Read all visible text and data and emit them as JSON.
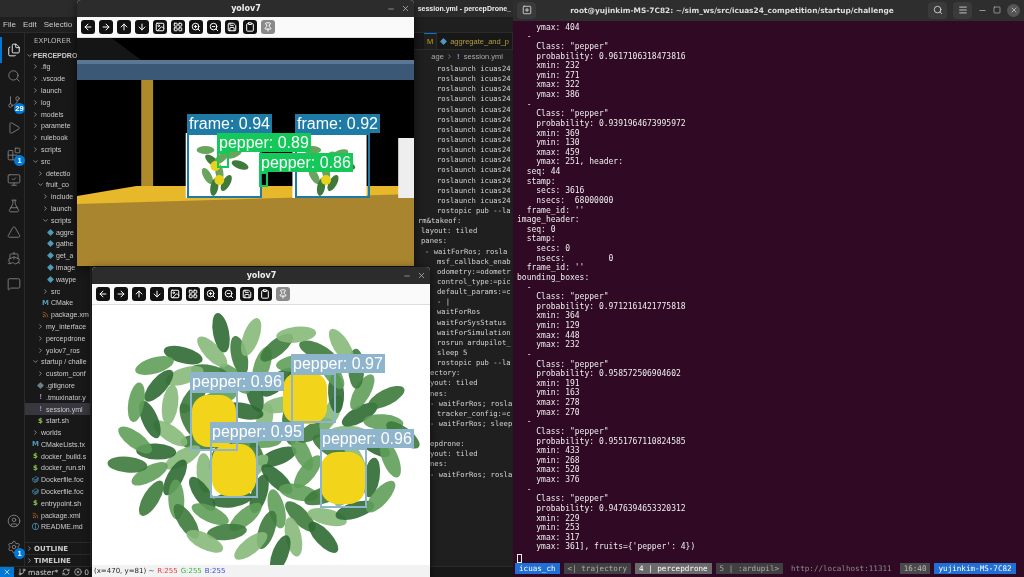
{
  "vscode": {
    "title": "session.yml - percepDrone_",
    "menu": [
      "File",
      "Edit",
      "Selectio"
    ],
    "activity": [
      {
        "kind": "files",
        "selected": true
      },
      {
        "kind": "search",
        "selected": false
      },
      {
        "kind": "source-control",
        "selected": false,
        "badge": "29"
      },
      {
        "kind": "run",
        "selected": false
      },
      {
        "kind": "extensions",
        "selected": false,
        "badge": "1"
      },
      {
        "kind": "remote",
        "selected": false
      },
      {
        "kind": "testing",
        "selected": false
      },
      {
        "kind": "deploy",
        "selected": false
      },
      {
        "kind": "docker",
        "selected": false
      },
      {
        "kind": "chat",
        "selected": false
      }
    ],
    "activity_bottom": [
      {
        "kind": "account",
        "selected": false
      },
      {
        "kind": "settings",
        "selected": false,
        "badge": "1"
      }
    ],
    "explorer": {
      "title": "EXPLORER",
      "root": "PERCEPDRO",
      "tree": [
        {
          "name": ".fig",
          "kind": "folder",
          "expanded": false,
          "selected": false
        },
        {
          "name": ".vscode",
          "kind": "folder",
          "expanded": false,
          "selected": false
        },
        {
          "name": "launch",
          "kind": "folder",
          "expanded": false,
          "selected": false
        },
        {
          "name": "log",
          "kind": "folder",
          "expanded": false,
          "selected": false
        },
        {
          "name": "models",
          "kind": "folder",
          "expanded": false,
          "selected": false
        },
        {
          "name": "paramete",
          "kind": "folder",
          "expanded": false,
          "selected": false
        },
        {
          "name": "rulebook",
          "kind": "folder",
          "expanded": false,
          "selected": false
        },
        {
          "name": "scripts",
          "kind": "folder",
          "expanded": false,
          "selected": false
        },
        {
          "name": "src",
          "kind": "folder",
          "expanded": true,
          "selected": false,
          "children": [
            {
              "name": "detectio",
              "kind": "folder",
              "expanded": false,
              "selected": false
            },
            {
              "name": "fruit_co",
              "kind": "folder",
              "expanded": true,
              "selected": false,
              "children": [
                {
                  "name": "include",
                  "kind": "folder",
                  "expanded": false,
                  "selected": false
                },
                {
                  "name": "launch",
                  "kind": "folder",
                  "expanded": false,
                  "selected": false
                },
                {
                  "name": "scripts",
                  "kind": "folder",
                  "expanded": true,
                  "selected": false,
                  "children": [
                    {
                      "name": "aggre",
                      "kind": "python",
                      "selected": false
                    },
                    {
                      "name": "gathe",
                      "kind": "python",
                      "selected": false
                    },
                    {
                      "name": "get_a",
                      "kind": "python",
                      "selected": false
                    },
                    {
                      "name": "image",
                      "kind": "python",
                      "selected": false
                    },
                    {
                      "name": "waype",
                      "kind": "python",
                      "selected": false
                    }
                  ]
                },
                {
                  "name": "src",
                  "kind": "folder",
                  "expanded": false,
                  "selected": false
                },
                {
                  "name": "CMake",
                  "kind": "cmake",
                  "glyph": "M",
                  "selected": false
                },
                {
                  "name": "package.xm",
                  "kind": "xml",
                  "selected": false
                }
              ]
            },
            {
              "name": "my_interface",
              "kind": "folder",
              "expanded": false,
              "selected": false
            },
            {
              "name": "percepdrone",
              "kind": "folder",
              "expanded": false,
              "selected": false
            },
            {
              "name": "yolov7_ros",
              "kind": "folder",
              "expanded": false,
              "selected": false
            }
          ]
        },
        {
          "name": "startup / challe",
          "kind": "folder",
          "expanded": true,
          "selected": false,
          "children": [
            {
              "name": "custom_conf",
              "kind": "folder",
              "expanded": false,
              "selected": false
            },
            {
              "name": ".gitignore",
              "kind": "git",
              "selected": false
            },
            {
              "name": ".tmuxinator.y",
              "kind": "yaml",
              "glyph": "!",
              "selected": false
            },
            {
              "name": "session.yml",
              "kind": "yaml",
              "glyph": "!",
              "selected": true
            },
            {
              "name": "start.sh",
              "kind": "shell",
              "glyph": "$",
              "selected": false
            }
          ]
        },
        {
          "name": "worlds",
          "kind": "folder",
          "expanded": false,
          "selected": false
        },
        {
          "name": "CMakeLists.tx",
          "kind": "cmake",
          "glyph": "M",
          "selected": false
        },
        {
          "name": "docker_build.s",
          "kind": "shell",
          "glyph": "$",
          "selected": false
        },
        {
          "name": "docker_run.sh",
          "kind": "shell",
          "glyph": "$",
          "selected": false
        },
        {
          "name": "Dockerfile.foc",
          "kind": "docker",
          "selected": false
        },
        {
          "name": "Dockerfile.foc",
          "kind": "docker",
          "selected": false
        },
        {
          "name": "entrypoint.sh",
          "kind": "shell",
          "glyph": "$",
          "selected": false
        },
        {
          "name": "package.xml",
          "kind": "xml",
          "selected": false
        },
        {
          "name": "README.md",
          "kind": "info",
          "glyph": "ⓘ",
          "selected": false
        }
      ],
      "sections": [
        "OUTLINE",
        "TIMELINE"
      ]
    },
    "tabs": [
      {
        "label": "M",
        "selected": true
      },
      {
        "label": "aggregate_and_p",
        "selected": false
      }
    ],
    "breadcrumb": {
      "folder": "age",
      "icon": "!",
      "file": "session.yml"
    },
    "code": [
      "roslaunch icuas24",
      "roslaunch icuas24",
      "roslaunch icuas24",
      "roslaunch icuas24",
      "roslaunch icuas24",
      "roslaunch icuas24",
      "roslaunch icuas24",
      "roslaunch icuas24",
      "roslaunch icuas24",
      "roslaunch icuas24",
      "roslaunch icuas24",
      "roslaunch icuas24",
      "roslaunch icuas24",
      "roslaunch icuas24",
      "rostopic pub --la",
      "rm&takeof:",
      "layout: tiled",
      "panes:",
      "- waitForRos; rosla",
      "msf_callback_enab",
      "odometry:=odometr",
      "control_type:=pic",
      "default_params:=c",
      "- |",
      "waitForRos",
      "waitForSysStatus",
      "waitForSimulation",
      "rosrun ardupilot_",
      "sleep 5",
      "rostopic pub --la",
      "ectory:",
      "yout: tiled",
      "nes:",
      "- waitForRos; rosla",
      "tracker_config:=c",
      "- waitForRos; sleep",
      "epdrone:",
      "yout: tiled",
      "nes:",
      "- waitForRos; rosla"
    ],
    "status": {
      "branch": "master*",
      "errors": "0"
    }
  },
  "terminal": {
    "title": "root@yujinkim-MS-7C82: ~/sim_ws/src/icuas24_competition/startup/challenge",
    "lines": [
      "    ymax: 404",
      "  -",
      "    Class: \"pepper\"",
      "    probability: 0.9617106318473816",
      "    xmin: 232",
      "    ymin: 271",
      "    xmax: 322",
      "    ymax: 386",
      "  -",
      "    Class: \"pepper\"",
      "    probability: 0.9391964673995972",
      "    xmin: 369",
      "    ymin: 130",
      "    xmax: 459",
      "    ymax: 251, header:",
      "  seq: 44",
      "  stamp:",
      "    secs: 3616",
      "    nsecs:  68000000",
      "  frame_id: ''",
      "image_header:",
      "  seq: 0",
      "  stamp:",
      "    secs: 0",
      "    nsecs:         0",
      "  frame_id: ''",
      "bounding_boxes:",
      "  -",
      "    Class: \"pepper\"",
      "    probability: 0.9712161421775818",
      "    xmin: 364",
      "    ymin: 129",
      "    xmax: 448",
      "    ymax: 232",
      "  -",
      "    Class: \"pepper\"",
      "    probability: 0.958572506904602",
      "    xmin: 191",
      "    ymin: 163",
      "    xmax: 278",
      "    ymax: 270",
      "  -",
      "    Class: \"pepper\"",
      "    probability: 0.9551767110824585",
      "    xmin: 433",
      "    ymin: 268",
      "    xmax: 520",
      "    ymax: 376",
      "  -",
      "    Class: \"pepper\"",
      "    probability: 0.9476394653320312",
      "    xmin: 229",
      "    ymin: 253",
      "    xmax: 317",
      "    ymax: 361], fruits={'pepper': 4})"
    ],
    "tmux": {
      "session": "icuas_ch",
      "windows": [
        {
          "label": "<| trajectory",
          "selected": false
        },
        {
          "label": "4 | percepdrone",
          "selected": true
        },
        {
          "label": "5 | :ardupil>",
          "selected": false
        }
      ],
      "url": "http://localhost:11311",
      "clock": "16:40",
      "host": "yujinkim-MS-7C82"
    }
  },
  "image_windows": [
    {
      "title": "yolov7",
      "kind": "arena",
      "toolbar": [
        {
          "kind": "left",
          "disabled": false
        },
        {
          "kind": "right",
          "disabled": false
        },
        {
          "kind": "up",
          "disabled": false
        },
        {
          "kind": "down",
          "disabled": false
        },
        {
          "kind": "frame",
          "disabled": false
        },
        {
          "kind": "grid",
          "disabled": false
        },
        {
          "kind": "zoom-in",
          "disabled": false
        },
        {
          "kind": "zoom-out",
          "disabled": false
        },
        {
          "kind": "save",
          "disabled": false
        },
        {
          "kind": "copy",
          "disabled": false
        },
        {
          "kind": "pin",
          "disabled": true
        }
      ],
      "detections": [
        {
          "label": "frame: 0.94",
          "color": "#1d7ba6"
        },
        {
          "label": "frame: 0.92",
          "color": "#1d7ba6"
        },
        {
          "label": "pepper: 0.89",
          "color": "#14c85a"
        },
        {
          "label": "pepper: 0.86",
          "color": "#14c85a"
        }
      ]
    },
    {
      "title": "yolov7",
      "kind": "plant",
      "toolbar": [
        {
          "kind": "left",
          "disabled": false
        },
        {
          "kind": "right",
          "disabled": false
        },
        {
          "kind": "up",
          "disabled": false
        },
        {
          "kind": "down",
          "disabled": false
        },
        {
          "kind": "frame",
          "disabled": false
        },
        {
          "kind": "grid",
          "disabled": false
        },
        {
          "kind": "zoom-in",
          "disabled": false
        },
        {
          "kind": "zoom-out",
          "disabled": false
        },
        {
          "kind": "save",
          "disabled": false
        },
        {
          "kind": "copy",
          "disabled": false
        },
        {
          "kind": "pin",
          "disabled": true
        }
      ],
      "detections": [
        {
          "label": "pepper: 0.96",
          "color": "#8fb5cd"
        },
        {
          "label": "pepper: 0.97",
          "color": "#8fb5cd"
        },
        {
          "label": "pepper: 0.95",
          "color": "#8fb5cd"
        },
        {
          "label": "pepper: 0.96",
          "color": "#8fb5cd"
        }
      ],
      "status": {
        "position": "(x=470, y=81) ~",
        "r": "R:255",
        "g": "G:255",
        "b": "B:255"
      }
    }
  ]
}
